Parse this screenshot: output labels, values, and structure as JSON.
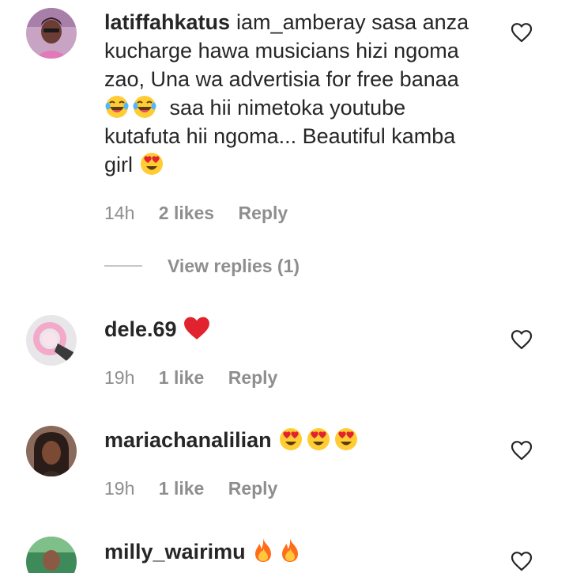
{
  "comments": [
    {
      "username": "latiffahkatus",
      "lines": [
        "iam_amberay sasa anza",
        "kucharge hawa musicians hizi ngoma",
        "zao, Una wa advertisia for free banaa",
        "saa hii nimetoka youtube",
        "kutafuta hii ngoma... Beautiful kamba",
        "girl"
      ],
      "emojis": [
        "face-with-tears-of-joy",
        "face-with-tears-of-joy",
        "smiling-face-with-heart-eyes"
      ],
      "time": "14h",
      "likes": "2 likes",
      "reply": "Reply",
      "view_replies": "View replies (1)"
    },
    {
      "username": "dele.69",
      "emojis": [
        "red-heart"
      ],
      "time": "19h",
      "likes": "1 like",
      "reply": "Reply"
    },
    {
      "username": "mariachanalilian",
      "emojis": [
        "smiling-face-with-heart-eyes",
        "smiling-face-with-heart-eyes",
        "smiling-face-with-heart-eyes"
      ],
      "time": "19h",
      "likes": "1 like",
      "reply": "Reply"
    },
    {
      "username": "milly_wairimu",
      "emojis": [
        "fire",
        "fire"
      ]
    }
  ],
  "colors": {
    "text": "#262626",
    "meta": "#8e8e8e",
    "heart_red": "#e0232e"
  },
  "icons": {
    "like": "heart-outline-icon"
  }
}
